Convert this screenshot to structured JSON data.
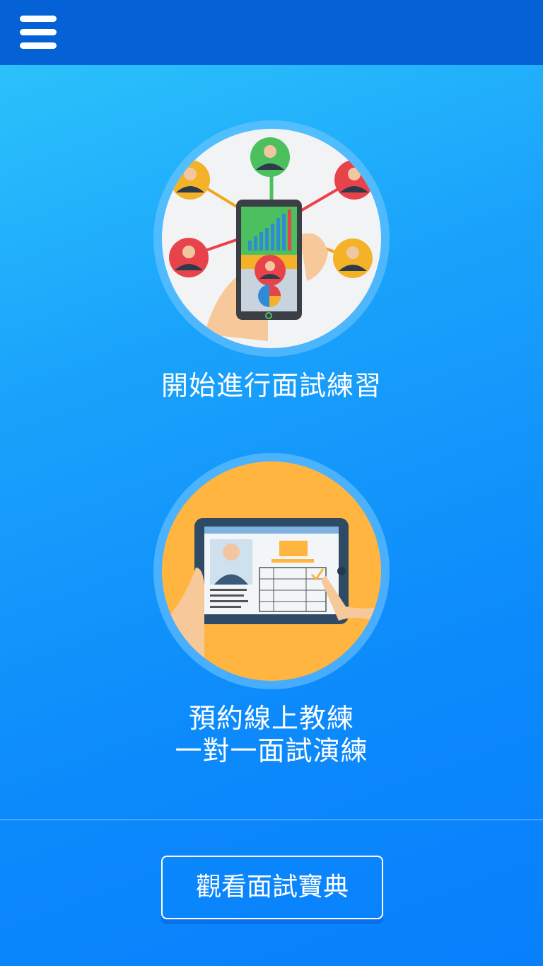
{
  "header": {
    "menu_icon": "hamburger-menu-icon",
    "bar_color": "#0562d6"
  },
  "cards": [
    {
      "label": "開始進行面試練習",
      "illustration": "phone-network-people-illustration"
    },
    {
      "label_line1": "預約線上教練",
      "label_line2": "一對一面試演練",
      "illustration": "tablet-resume-illustration"
    }
  ],
  "footer": {
    "guide_button_label": "觀看面試寶典"
  },
  "colors": {
    "background_top": "#2ec8fb",
    "background_bottom": "#0880fc",
    "illustration1_bg": "#f2f3f5",
    "illustration2_bg": "#ffb53f"
  }
}
